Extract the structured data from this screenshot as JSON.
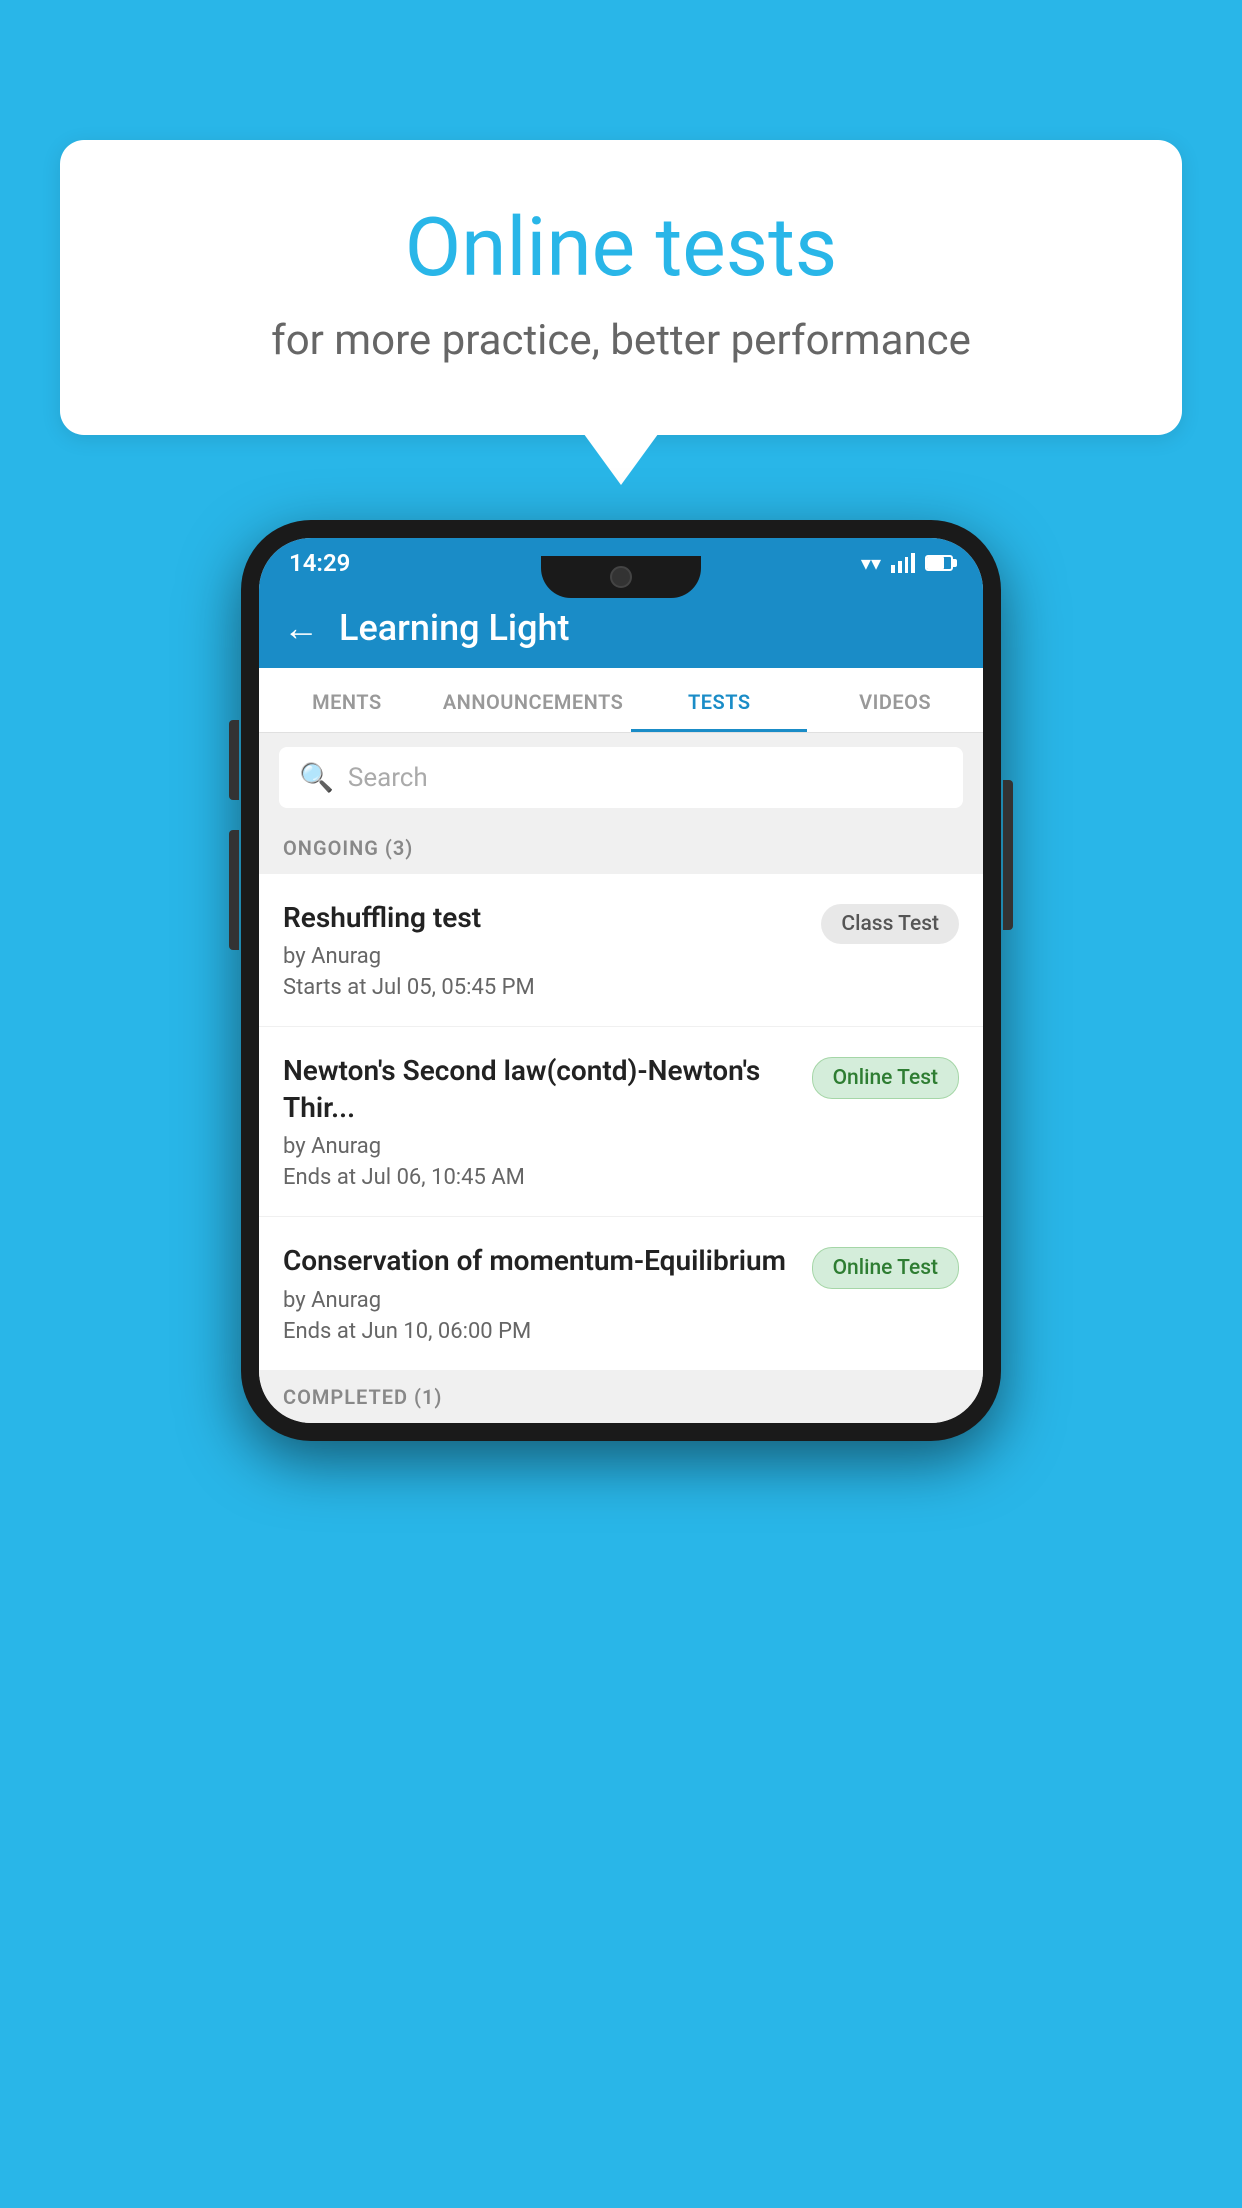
{
  "background_color": "#29B6E8",
  "speech_bubble": {
    "title": "Online tests",
    "subtitle": "for more practice, better performance"
  },
  "phone": {
    "status_bar": {
      "time": "14:29"
    },
    "header": {
      "title": "Learning Light",
      "back_label": "←"
    },
    "tabs": [
      {
        "label": "MENTS",
        "active": false
      },
      {
        "label": "ANNOUNCEMENTS",
        "active": false
      },
      {
        "label": "TESTS",
        "active": true
      },
      {
        "label": "VIDEOS",
        "active": false
      }
    ],
    "search": {
      "placeholder": "Search"
    },
    "section_ongoing": {
      "label": "ONGOING (3)"
    },
    "tests": [
      {
        "name": "Reshuffling test",
        "author": "by Anurag",
        "date": "Starts at  Jul 05, 05:45 PM",
        "badge": "Class Test",
        "badge_type": "class"
      },
      {
        "name": "Newton's Second law(contd)-Newton's Thir...",
        "author": "by Anurag",
        "date": "Ends at  Jul 06, 10:45 AM",
        "badge": "Online Test",
        "badge_type": "online"
      },
      {
        "name": "Conservation of momentum-Equilibrium",
        "author": "by Anurag",
        "date": "Ends at  Jun 10, 06:00 PM",
        "badge": "Online Test",
        "badge_type": "online"
      }
    ],
    "section_completed": {
      "label": "COMPLETED (1)"
    }
  }
}
